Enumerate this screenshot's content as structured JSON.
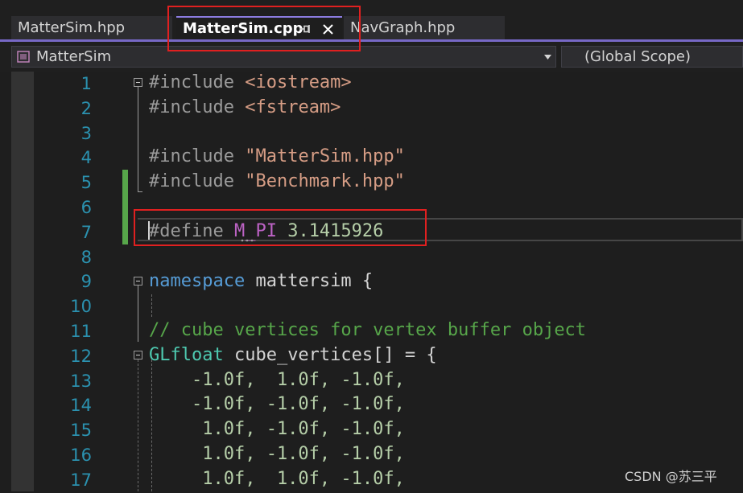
{
  "tabs": [
    {
      "label": "MatterSim.hpp",
      "active": false
    },
    {
      "label": "MatterSim.cpp",
      "active": true
    },
    {
      "label": "NavGraph.hpp",
      "active": false
    }
  ],
  "nav": {
    "project": "MatterSim",
    "scope": "(Global Scope)"
  },
  "editor": {
    "line_numbers": [
      "1",
      "2",
      "3",
      "4",
      "5",
      "6",
      "7",
      "8",
      "9",
      "10",
      "11",
      "12",
      "13",
      "14",
      "15",
      "16",
      "17"
    ],
    "code": {
      "l1_a": "#include ",
      "l1_b": "<iostream>",
      "l2_a": "#include ",
      "l2_b": "<fstream>",
      "l4_a": "#include ",
      "l4_b": "\"MatterSim.hpp\"",
      "l5_a": "#include ",
      "l5_b": "\"Benchmark.hpp\"",
      "l7_a": "#define ",
      "l7_b": "M_PI",
      "l7_c": " 3.1415926",
      "l9_a": "namespace",
      "l9_b": " mattersim {",
      "l11": "// cube vertices for vertex buffer object",
      "l12_a": "GLfloat",
      "l12_b": " cube_vertices[] = {",
      "l13": "    -1.0f,  1.0f, -1.0f,",
      "l14": "    -1.0f, -1.0f, -1.0f,",
      "l15": "     1.0f, -1.0f, -1.0f,",
      "l16": "     1.0f, -1.0f, -1.0f,",
      "l17": "     1.0f,  1.0f, -1.0f,"
    }
  },
  "watermark": "CSDN @苏三平",
  "colors": {
    "accent": "#7768c6",
    "change_bar": "#57a64a",
    "annotation": "#e02020"
  },
  "icons": {
    "pin": "pin-icon",
    "close": "close-icon",
    "class": "class-icon",
    "dropdown": "chevron-down-icon"
  }
}
